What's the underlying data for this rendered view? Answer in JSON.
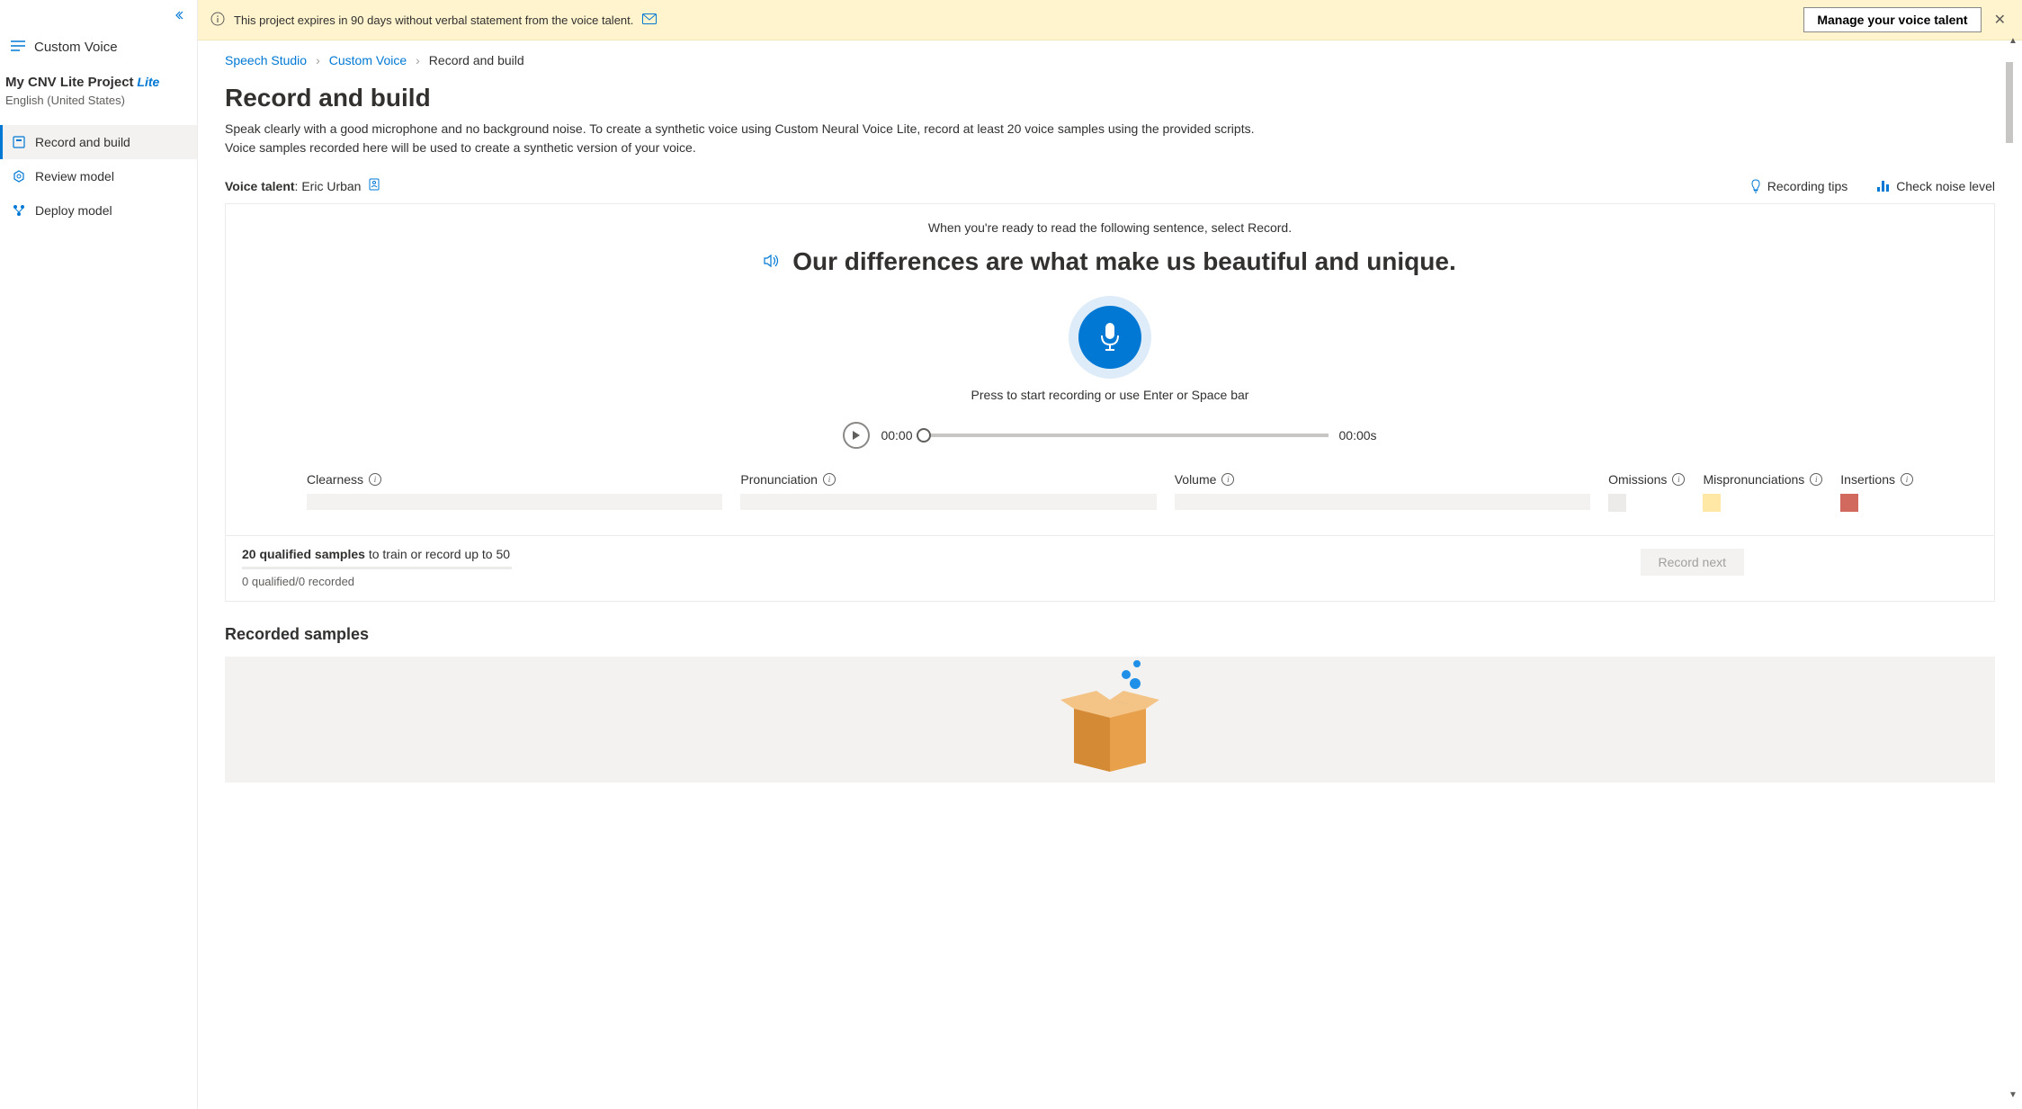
{
  "sidebar": {
    "workspace_label": "Custom Voice",
    "project_name": "My CNV Lite Project",
    "lite_badge": "Lite",
    "project_language": "English (United States)",
    "items": [
      {
        "label": "Record and build",
        "active": true
      },
      {
        "label": "Review model",
        "active": false
      },
      {
        "label": "Deploy model",
        "active": false
      }
    ]
  },
  "banner": {
    "text": "This project expires in 90 days without verbal statement from the voice talent.",
    "button": "Manage your voice talent"
  },
  "breadcrumb": {
    "items": [
      "Speech Studio",
      "Custom Voice",
      "Record and build"
    ]
  },
  "page": {
    "title": "Record and build",
    "description": "Speak clearly with a good microphone and no background noise. To create a synthetic voice using Custom Neural Voice Lite, record at least 20 voice samples using the provided scripts. Voice samples recorded here will be used to create a synthetic version of your voice."
  },
  "talent": {
    "label": "Voice talent",
    "name": "Eric Urban"
  },
  "tips": {
    "recording_tips": "Recording tips",
    "check_noise": "Check noise level"
  },
  "recording": {
    "ready_text": "When you're ready to read the following sentence, select Record.",
    "script": "Our differences are what make us beautiful and unique.",
    "mic_hint": "Press to start recording or use Enter or Space bar",
    "time_current": "00:00",
    "time_total": "00:00s"
  },
  "metrics": {
    "clearness": "Clearness",
    "pronunciation": "Pronunciation",
    "volume": "Volume",
    "omissions": "Omissions",
    "mispronunciations": "Mispronunciations",
    "insertions": "Insertions"
  },
  "samples": {
    "qualified_count": "20 qualified samples",
    "qualified_suffix": " to train or record up to 50",
    "status": "0 qualified/0 recorded",
    "record_next": "Record next"
  },
  "recorded": {
    "title": "Recorded samples"
  }
}
